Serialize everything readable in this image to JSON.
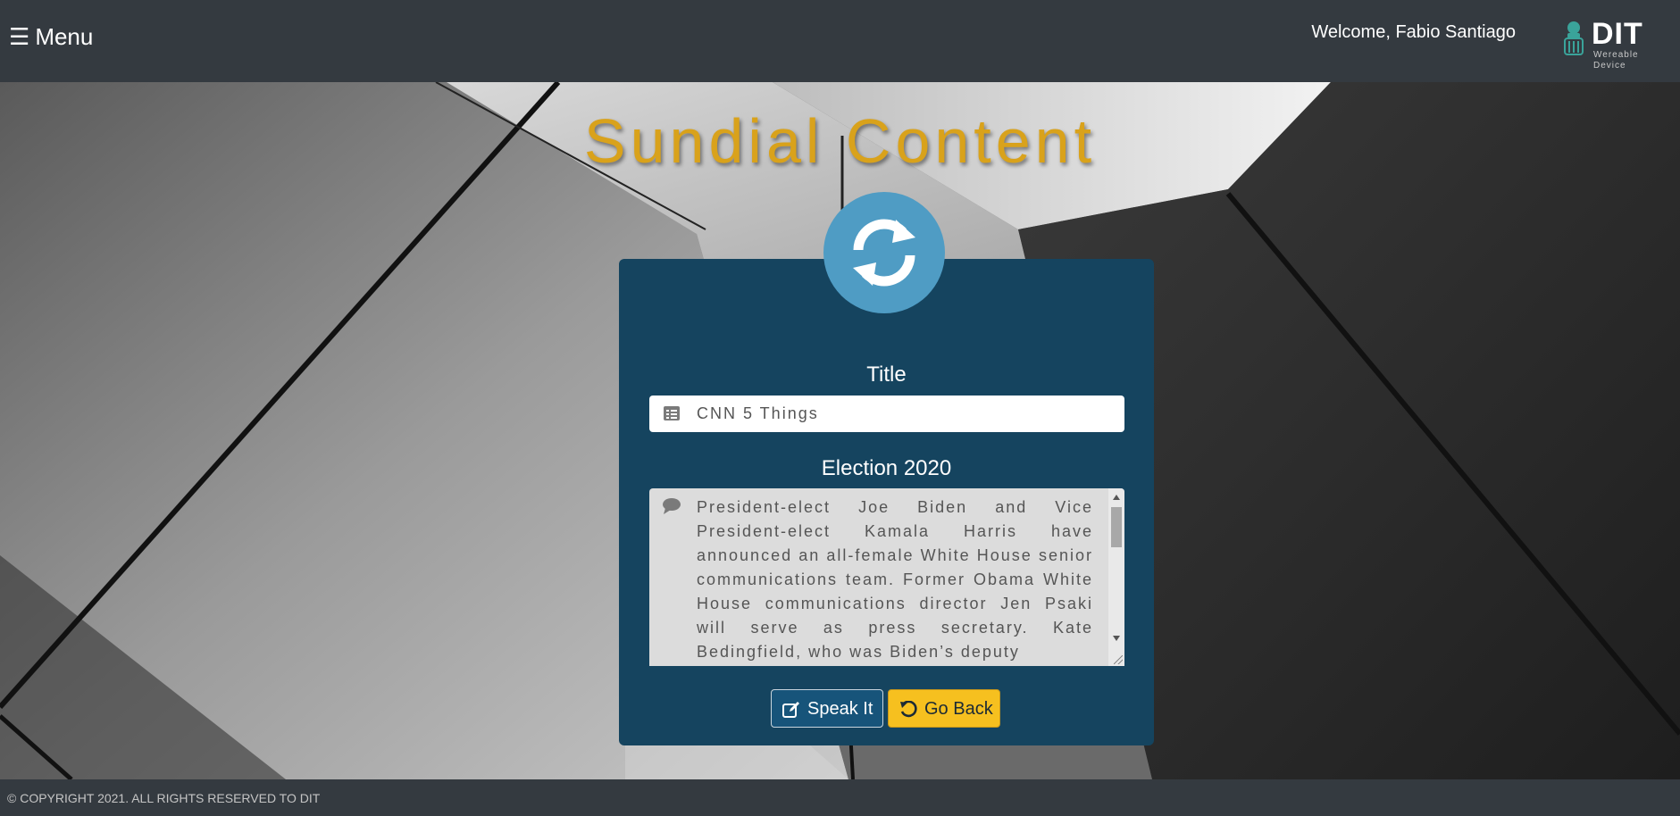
{
  "header": {
    "menu_label": "Menu",
    "menu_icon": "hamburger-icon",
    "welcome_text": "Welcome, Fabio Santiago",
    "logo_text": "DIT",
    "logo_subtext": "Wereable Device"
  },
  "page": {
    "title": "Sundial Content",
    "hero_icon": "sync-icon"
  },
  "form": {
    "title_label": "Title",
    "title_value": "CNN 5 Things",
    "title_icon": "list-icon",
    "body_label": "Election 2020",
    "body_icon": "comment-icon",
    "body_value": "President-elect Joe Biden and Vice President-elect Kamala Harris have announced an all-female White House senior communications team. Former Obama White House communications director Jen Psaki will serve as press secretary. Kate Bedingfield, who was Biden’s deputy"
  },
  "buttons": {
    "speak_label": "Speak It",
    "speak_icon": "edit-icon",
    "back_label": "Go Back",
    "back_icon": "undo-icon"
  },
  "footer": {
    "copyright": "© COPYRIGHT 2021. ALL RIGHTS RESERVED TO DIT"
  },
  "colors": {
    "header_bg": "#343a40",
    "card_bg": "#15445f",
    "title_gold": "#d9a21b",
    "sync_circle": "#4f9cc4",
    "speak_btn": "#17547a",
    "back_btn": "#f6c01f"
  }
}
